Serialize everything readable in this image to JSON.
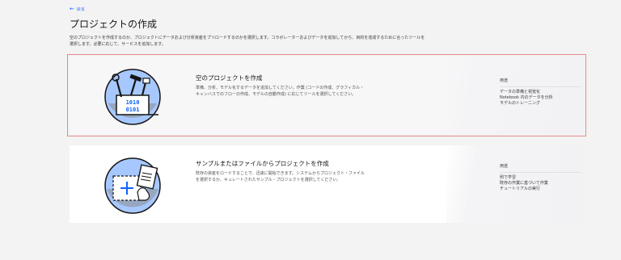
{
  "nav": {
    "back_label": "戻る"
  },
  "page": {
    "title": "プロジェクトの作成",
    "description": "空のプロジェクトを作成するのか、プロジェクトにデータおよび分析資産をプリロードするのかを選択します。コラボレーターおよびデータを追加してから、目的を達成するために合ったツールを選択します。必要に応じて、サービスを追加します。"
  },
  "cards": [
    {
      "title": "空のプロジェクトを作成",
      "text": "準備、分析、モデル化するデータを追加してください。作業 (コードの作成、グラフィカル・キャンバスでのフローの作成、モデルの自動作成) に応じてツールを選択してください。",
      "uses_label": "用途",
      "uses": [
        "データの準備と視覚化",
        "Notebook 内のデータを分析",
        "モデルのトレーニング"
      ],
      "illustration_text": [
        "1010",
        "0101"
      ]
    },
    {
      "title": "サンプルまたはファイルからプロジェクトを作成",
      "text": "既存の資産をロードすることで、迅速に開始できます。システムからプロジェクト・ファイルを選択するか、キュレートされたサンプル・プロジェクトを選択してください。",
      "uses_label": "用途",
      "uses": [
        "例で学習",
        "既存の作業に基づいて作業",
        "チュートリアルの実行"
      ]
    }
  ],
  "colors": {
    "accent": "#0f62fe",
    "illustration_blue": "#a6c8ff",
    "illustration_dark": "#161616",
    "illustration_gray": "#8d8d8d"
  }
}
